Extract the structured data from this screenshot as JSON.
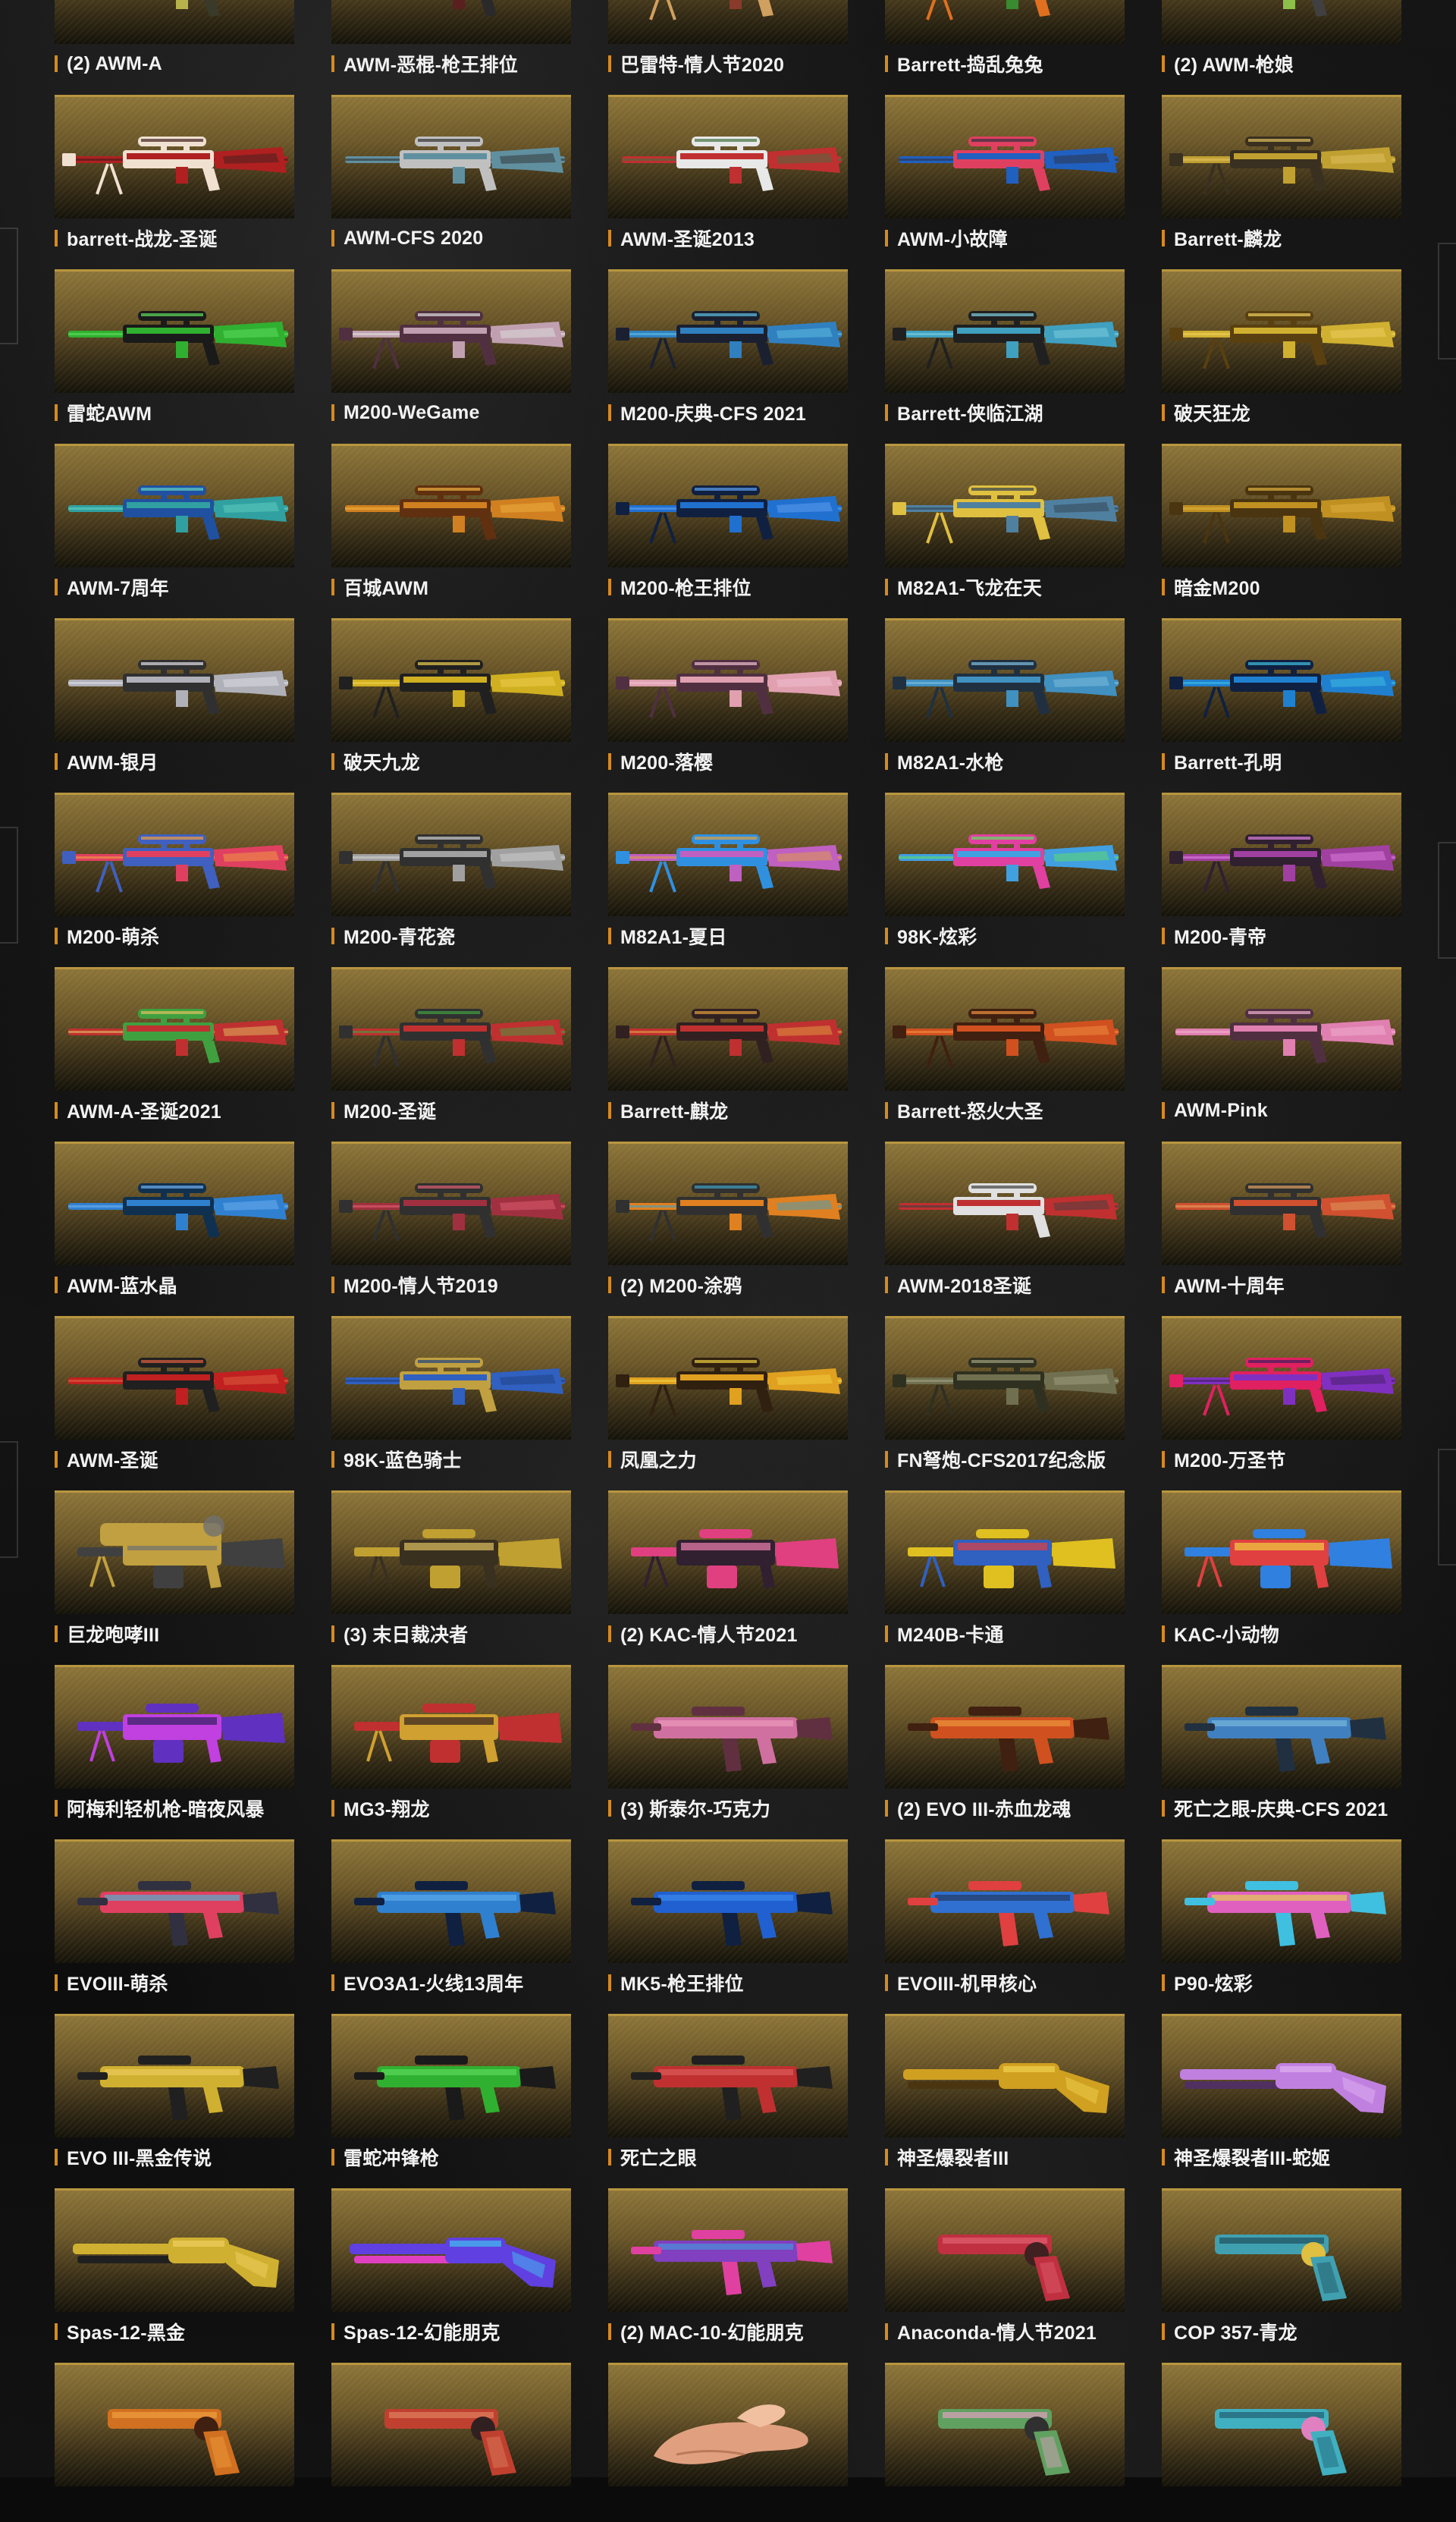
{
  "gallery": {
    "items": [
      {
        "label": "(2) AWM-A",
        "kind": "rifle",
        "colors": [
          "#b7b24a",
          "#3a3a2a",
          "#d9d36a"
        ]
      },
      {
        "label": "AWM-恶棍-枪王排位",
        "kind": "rifle",
        "colors": [
          "#5a2020",
          "#2a2a2a",
          "#d04030"
        ]
      },
      {
        "label": "巴雷特-情人节2020",
        "kind": "sniper",
        "colors": [
          "#8a3a2a",
          "#d0a060",
          "#402020"
        ]
      },
      {
        "label": "Barrett-捣乱兔兔",
        "kind": "sniper",
        "colors": [
          "#3a8a30",
          "#e07020",
          "#202020"
        ]
      },
      {
        "label": "(2) AWM-枪娘",
        "kind": "rifle",
        "colors": [
          "#8cc04a",
          "#404040",
          "#c0d070"
        ]
      },
      {
        "label": "barrett-战龙-圣诞",
        "kind": "sniper",
        "colors": [
          "#b02020",
          "#f0e0d0",
          "#402020"
        ]
      },
      {
        "label": "AWM-CFS 2020",
        "kind": "rifle",
        "colors": [
          "#6090a0",
          "#c0c0c0",
          "#303030"
        ]
      },
      {
        "label": "AWM-圣诞2013",
        "kind": "rifle",
        "colors": [
          "#c03030",
          "#e8e8e8",
          "#407040"
        ]
      },
      {
        "label": "AWM-小故障",
        "kind": "rifle",
        "colors": [
          "#2060c0",
          "#e04060",
          "#303040"
        ]
      },
      {
        "label": "Barrett-麟龙",
        "kind": "sniper",
        "colors": [
          "#c0a030",
          "#3a3020",
          "#e0c060"
        ]
      },
      {
        "label": "雷蛇AWM",
        "kind": "rifle",
        "colors": [
          "#30b030",
          "#1a1a1a",
          "#60e060"
        ]
      },
      {
        "label": "M200-WeGame",
        "kind": "sniper",
        "colors": [
          "#c0a0b0",
          "#503040",
          "#e0e0e0"
        ]
      },
      {
        "label": "M200-庆典-CFS 2021",
        "kind": "sniper",
        "colors": [
          "#3080c0",
          "#1a2030",
          "#60c0e0"
        ]
      },
      {
        "label": "Barrett-侠临江湖",
        "kind": "sniper",
        "colors": [
          "#40a0c0",
          "#202020",
          "#80d0e0"
        ]
      },
      {
        "label": "破天狂龙",
        "kind": "sniper",
        "colors": [
          "#d0b030",
          "#5a4010",
          "#f0d060"
        ]
      },
      {
        "label": "AWM-7周年",
        "kind": "rifle",
        "colors": [
          "#30a0a0",
          "#2050a0",
          "#60d0c0"
        ]
      },
      {
        "label": "百城AWM",
        "kind": "rifle",
        "colors": [
          "#d08020",
          "#603010",
          "#f0b040"
        ]
      },
      {
        "label": "M200-枪王排位",
        "kind": "sniper",
        "colors": [
          "#2070d0",
          "#102040",
          "#60a0f0"
        ]
      },
      {
        "label": "M82A1-飞龙在天",
        "kind": "sniper",
        "colors": [
          "#5080a0",
          "#e0c040",
          "#304050"
        ]
      },
      {
        "label": "暗金M200",
        "kind": "sniper",
        "colors": [
          "#c09020",
          "#4a3510",
          "#e0b040"
        ]
      },
      {
        "label": "AWM-银月",
        "kind": "rifle",
        "colors": [
          "#b0b0b8",
          "#303030",
          "#e0e0e8"
        ]
      },
      {
        "label": "破天九龙",
        "kind": "sniper",
        "colors": [
          "#d0b020",
          "#202020",
          "#f0d050"
        ]
      },
      {
        "label": "M200-落樱",
        "kind": "sniper",
        "colors": [
          "#e0a0b0",
          "#503040",
          "#f0c0d0"
        ]
      },
      {
        "label": "M82A1-水枪",
        "kind": "sniper",
        "colors": [
          "#4090c0",
          "#203040",
          "#80c0e0"
        ]
      },
      {
        "label": "Barrett-孔明",
        "kind": "sniper",
        "colors": [
          "#2080d0",
          "#102040",
          "#40c0e0"
        ]
      },
      {
        "label": "M200-萌杀",
        "kind": "sniper",
        "colors": [
          "#e04060",
          "#4060c0",
          "#f0a040"
        ]
      },
      {
        "label": "M200-青花瓷",
        "kind": "sniper",
        "colors": [
          "#a0a0a0",
          "#303030",
          "#d0d0d0"
        ]
      },
      {
        "label": "M82A1-夏日",
        "kind": "sniper",
        "colors": [
          "#c060c0",
          "#3090e0",
          "#e0a040"
        ]
      },
      {
        "label": "98K-炫彩",
        "kind": "rifle",
        "colors": [
          "#40a0e0",
          "#e040a0",
          "#60e060"
        ]
      },
      {
        "label": "M200-青帝",
        "kind": "sniper",
        "colors": [
          "#a040a0",
          "#302030",
          "#e080e0"
        ]
      },
      {
        "label": "AWM-A-圣诞2021",
        "kind": "rifle",
        "colors": [
          "#c03030",
          "#40a040",
          "#e0c060"
        ]
      },
      {
        "label": "M200-圣诞",
        "kind": "sniper",
        "colors": [
          "#c03030",
          "#303030",
          "#40a040"
        ]
      },
      {
        "label": "Barrett-麒龙",
        "kind": "sniper",
        "colors": [
          "#c03030",
          "#302020",
          "#e0a040"
        ]
      },
      {
        "label": "Barrett-怒火大圣",
        "kind": "sniper",
        "colors": [
          "#d05020",
          "#402010",
          "#f09040"
        ]
      },
      {
        "label": "AWM-Pink",
        "kind": "rifle",
        "colors": [
          "#e080b0",
          "#503040",
          "#f0b0d0"
        ]
      },
      {
        "label": "AWM-蓝水晶",
        "kind": "rifle",
        "colors": [
          "#3080d0",
          "#103050",
          "#70b0f0"
        ]
      },
      {
        "label": "M200-情人节2019",
        "kind": "sniper",
        "colors": [
          "#a03040",
          "#303030",
          "#e06070"
        ]
      },
      {
        "label": "(2) M200-涂鸦",
        "kind": "sniper",
        "colors": [
          "#e08020",
          "#303030",
          "#40a0c0"
        ]
      },
      {
        "label": "AWM-2018圣诞",
        "kind": "rifle",
        "colors": [
          "#c03030",
          "#e0e0e0",
          "#404040"
        ]
      },
      {
        "label": "AWM-十周年",
        "kind": "rifle",
        "colors": [
          "#d05030",
          "#303030",
          "#e0a060"
        ]
      },
      {
        "label": "AWM-圣诞",
        "kind": "rifle",
        "colors": [
          "#c02020",
          "#202020",
          "#e06040"
        ]
      },
      {
        "label": "98K-蓝色骑士",
        "kind": "rifle",
        "colors": [
          "#3060c0",
          "#c0a040",
          "#204080"
        ]
      },
      {
        "label": "凤凰之力",
        "kind": "sniper",
        "colors": [
          "#e0a020",
          "#302010",
          "#f0d040"
        ]
      },
      {
        "label": "FN弩炮-CFS2017纪念版",
        "kind": "sniper",
        "colors": [
          "#707050",
          "#303020",
          "#a0a080"
        ]
      },
      {
        "label": "M200-万圣节",
        "kind": "sniper",
        "colors": [
          "#8030c0",
          "#e02060",
          "#402060"
        ]
      },
      {
        "label": "巨龙咆哮III",
        "kind": "heavy",
        "colors": [
          "#404040",
          "#c0a040",
          "#707070"
        ]
      },
      {
        "label": "(3) 末日裁决者",
        "kind": "lmg",
        "colors": [
          "#c0a030",
          "#3a3020",
          "#e0c060"
        ]
      },
      {
        "label": "(2) KAC-情人节2021",
        "kind": "lmg",
        "colors": [
          "#e04080",
          "#302030",
          "#f080b0"
        ]
      },
      {
        "label": "M240B-卡通",
        "kind": "lmg",
        "colors": [
          "#e0c020",
          "#3060c0",
          "#e04040"
        ]
      },
      {
        "label": "KAC-小动物",
        "kind": "lmg",
        "colors": [
          "#3080e0",
          "#e04040",
          "#f0d040"
        ]
      },
      {
        "label": "阿梅利轻机枪-暗夜风暴",
        "kind": "lmg",
        "colors": [
          "#6030c0",
          "#c040e0",
          "#302060"
        ]
      },
      {
        "label": "MG3-翔龙",
        "kind": "lmg",
        "colors": [
          "#c03030",
          "#d0a030",
          "#302020"
        ]
      },
      {
        "label": "(3) 斯泰尔-巧克力",
        "kind": "smg",
        "colors": [
          "#d070a0",
          "#603040",
          "#f0a0c0"
        ]
      },
      {
        "label": "(2) EVO III-赤血龙魂",
        "kind": "smg",
        "colors": [
          "#d05020",
          "#402010",
          "#f0a040"
        ]
      },
      {
        "label": "死亡之眼-庆典-CFS 2021",
        "kind": "smg",
        "colors": [
          "#4080c0",
          "#203040",
          "#80c0e0"
        ]
      },
      {
        "label": "EVOIII-萌杀",
        "kind": "smg",
        "colors": [
          "#e04060",
          "#303040",
          "#40c0e0"
        ]
      },
      {
        "label": "EVO3A1-火线13周年",
        "kind": "smg",
        "colors": [
          "#3080d0",
          "#102040",
          "#60b0f0"
        ]
      },
      {
        "label": "MK5-枪王排位",
        "kind": "smg",
        "colors": [
          "#2060d0",
          "#102040",
          "#4090f0"
        ]
      },
      {
        "label": "EVOIII-机甲核心",
        "kind": "smg",
        "colors": [
          "#3070d0",
          "#e04040",
          "#203050"
        ]
      },
      {
        "label": "P90-炫彩",
        "kind": "smg",
        "colors": [
          "#e060c0",
          "#40c0e0",
          "#e0e040"
        ]
      },
      {
        "label": "EVO III-黑金传说",
        "kind": "smg",
        "colors": [
          "#d0b030",
          "#202020",
          "#f0d060"
        ]
      },
      {
        "label": "雷蛇冲锋枪",
        "kind": "smg",
        "colors": [
          "#30b030",
          "#1a1a1a",
          "#60e060"
        ]
      },
      {
        "label": "死亡之眼",
        "kind": "smg",
        "colors": [
          "#c03030",
          "#202020",
          "#e06060"
        ]
      },
      {
        "label": "神圣爆裂者III",
        "kind": "shotgun",
        "colors": [
          "#d0a020",
          "#4a3510",
          "#f0d050"
        ]
      },
      {
        "label": "神圣爆裂者III-蛇姬",
        "kind": "shotgun",
        "colors": [
          "#c080e0",
          "#503060",
          "#e0b0f0"
        ]
      },
      {
        "label": "Spas-12-黑金",
        "kind": "shotgun",
        "colors": [
          "#d0b030",
          "#202020",
          "#f0d060"
        ]
      },
      {
        "label": "Spas-12-幻能朋克",
        "kind": "shotgun",
        "colors": [
          "#6040e0",
          "#e040c0",
          "#40c0f0"
        ]
      },
      {
        "label": "(2) MAC-10-幻能朋克",
        "kind": "smg",
        "colors": [
          "#8040c0",
          "#e040a0",
          "#40a0e0"
        ]
      },
      {
        "label": "Anaconda-情人节2021",
        "kind": "pistol",
        "colors": [
          "#c03040",
          "#402020",
          "#e06070"
        ]
      },
      {
        "label": "COP 357-青龙",
        "kind": "pistol",
        "colors": [
          "#40a0b0",
          "#e0c040",
          "#205060"
        ]
      },
      {
        "label": "",
        "kind": "pistol",
        "colors": [
          "#d07020",
          "#402010",
          "#f0a040"
        ]
      },
      {
        "label": "",
        "kind": "pistol",
        "colors": [
          "#c04030",
          "#302020",
          "#e08060"
        ]
      },
      {
        "label": "",
        "kind": "hand",
        "colors": [
          "#e0a080",
          "#a06040",
          "#f0c0a0"
        ]
      },
      {
        "label": "",
        "kind": "pistol",
        "colors": [
          "#60a060",
          "#303030",
          "#e0a0c0"
        ]
      },
      {
        "label": "",
        "kind": "pistol",
        "colors": [
          "#40b0c0",
          "#e080c0",
          "#206070"
        ]
      }
    ]
  }
}
